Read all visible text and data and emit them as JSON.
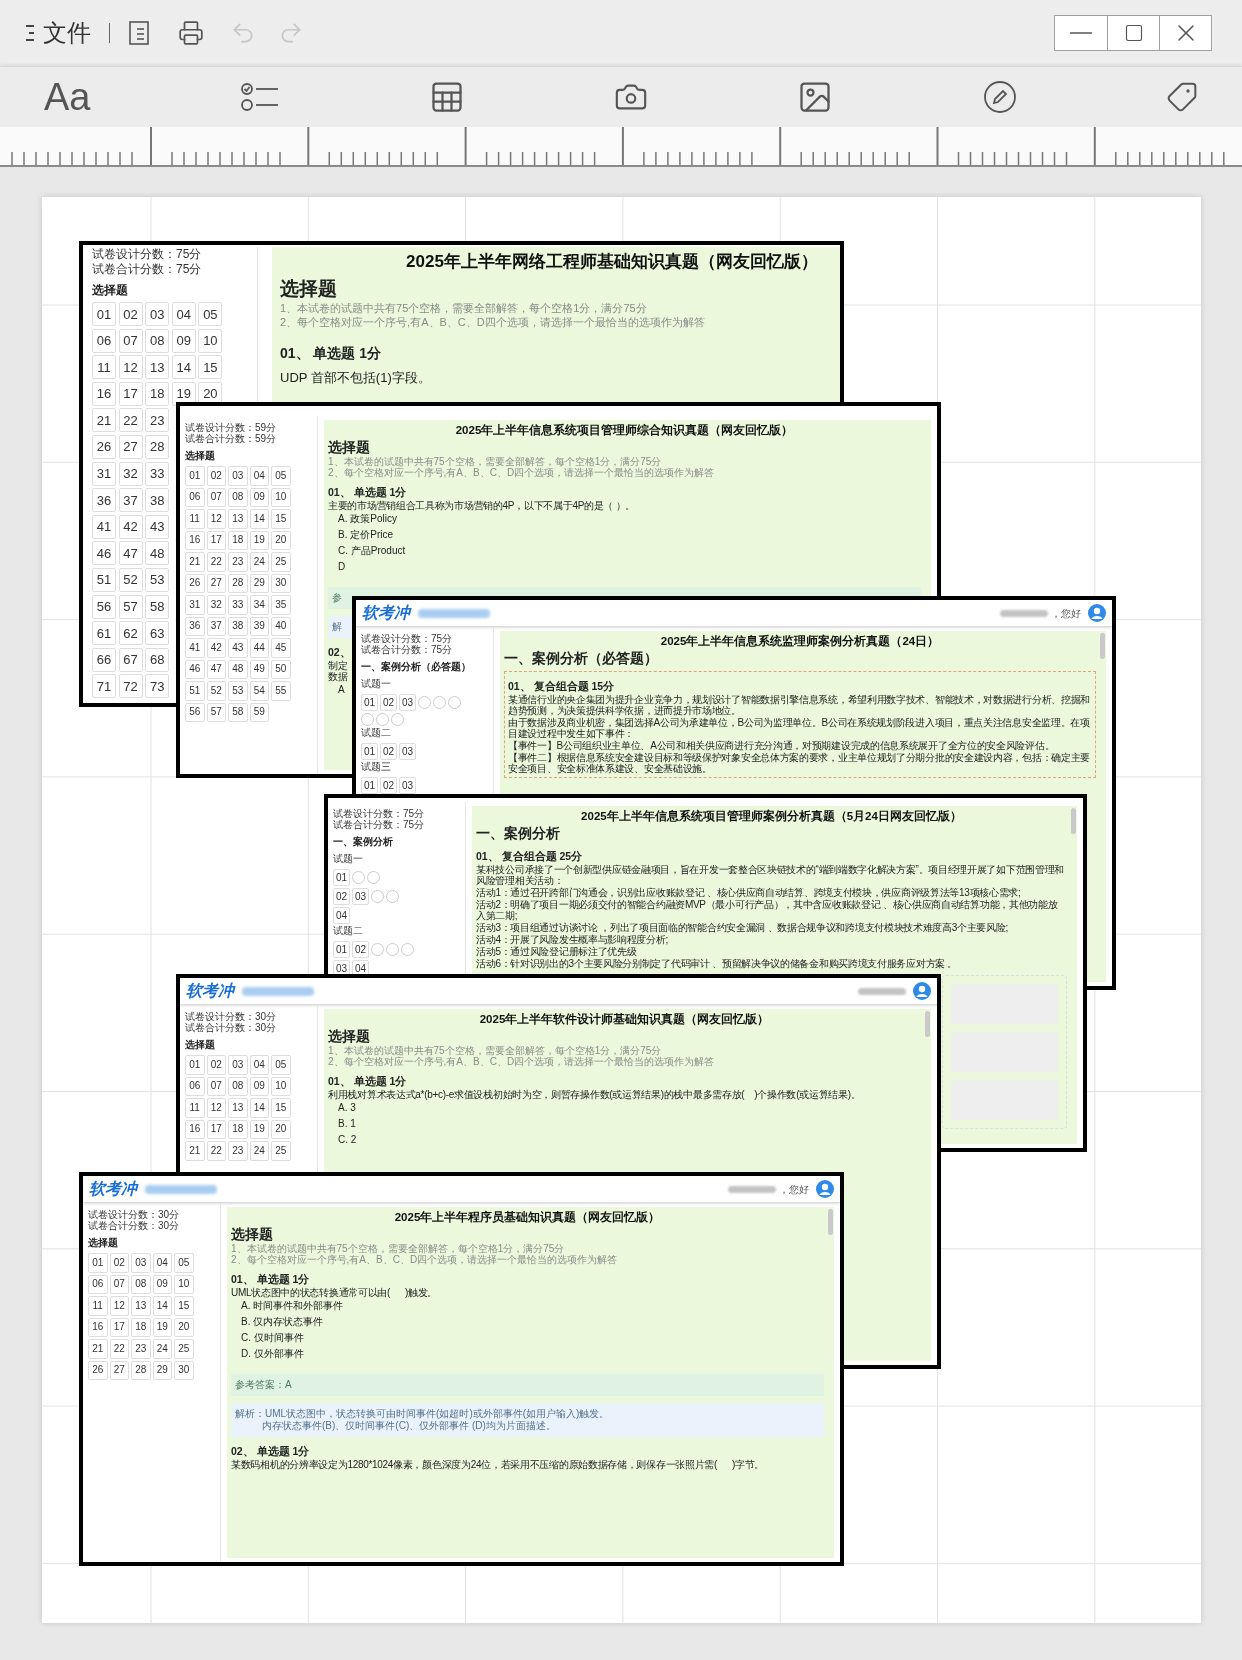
{
  "title_bar": {
    "menu_label": "文件",
    "undo": {
      "disabled": true
    },
    "redo": {
      "disabled": true
    }
  },
  "toolbar": {
    "font_button": "Aa"
  },
  "cards": [
    {
      "sidebar": {
        "scores": [
          "试卷设计分数：75分",
          "试卷合计分数：75分"
        ],
        "section": "选择题",
        "groups": [
          {
            "rows": [
              [
                "01",
                "02",
                "03",
                "04",
                "05"
              ],
              [
                "06",
                "07",
                "08",
                "09",
                "10"
              ],
              [
                "11",
                "12",
                "13",
                "14",
                "15"
              ],
              [
                "16",
                "17",
                "18",
                "19",
                "20"
              ],
              [
                "21",
                "22",
                "23"
              ],
              [
                "26",
                "27",
                "28"
              ],
              [
                "31",
                "32",
                "33"
              ],
              [
                "36",
                "37",
                "38"
              ],
              [
                "41",
                "42",
                "43"
              ],
              [
                "46",
                "47",
                "48"
              ],
              [
                "51",
                "52",
                "53"
              ],
              [
                "56",
                "57",
                "58"
              ],
              [
                "61",
                "62",
                "63"
              ],
              [
                "66",
                "67",
                "68"
              ],
              [
                "71",
                "72",
                "73"
              ]
            ]
          }
        ]
      },
      "main": [
        {
          "kind": "title",
          "text": "2025年上半年网络工程师基础知识真题（网友回忆版）"
        },
        {
          "kind": "heading",
          "text": "选择题"
        },
        {
          "kind": "notes",
          "lines": [
            "1、本试卷的试题中共有75个空格，需要全部解答，每个空格1分，满分75分",
            "2、每个空格对应一个序号,有A、B、C、D四个选项，请选择一个最恰当的选项作为解答"
          ]
        },
        {
          "kind": "qhead",
          "text": "01、 单选题 1分"
        },
        {
          "kind": "text",
          "text": "UDP 首部不包括(1)字段。"
        }
      ]
    },
    {
      "sidebar": {
        "scores": [
          "试卷设计分数：59分",
          "试卷合计分数：59分"
        ],
        "section": "选择题",
        "groups": [
          {
            "rows": [
              [
                "01",
                "02",
                "03",
                "04",
                "05"
              ],
              [
                "06",
                "07",
                "08",
                "09",
                "10"
              ],
              [
                "11",
                "12",
                "13",
                "14",
                "15"
              ],
              [
                "16",
                "17",
                "18",
                "19",
                "20"
              ],
              [
                "21",
                "22",
                "23",
                "24",
                "25"
              ],
              [
                "26",
                "27",
                "28",
                "29",
                "30"
              ],
              [
                "31",
                "32",
                "33",
                "34",
                "35"
              ],
              [
                "36",
                "37",
                "38",
                "39",
                "40"
              ],
              [
                "41",
                "42",
                "43",
                "44",
                "45"
              ],
              [
                "46",
                "47",
                "48",
                "49",
                "50"
              ],
              [
                "51",
                "52",
                "53",
                "54",
                "55"
              ],
              [
                "56",
                "57",
                "58",
                "59"
              ]
            ]
          }
        ]
      },
      "main": [
        {
          "kind": "title",
          "text": "2025年上半年信息系统项目管理师综合知识真题（网友回忆版）"
        },
        {
          "kind": "heading",
          "text": "选择题"
        },
        {
          "kind": "notes",
          "lines": [
            "1、本试卷的试题中共有75个空格，需要全部解答，每个空格1分，满分75分",
            "2、每个空格对应一个序号,有A、B、C、D四个选项，请选择一个最恰当的选项作为解答"
          ]
        },
        {
          "kind": "qhead",
          "text": "01、 单选题 1分"
        },
        {
          "kind": "text",
          "text": "主要的市场营销组合工具称为市场营销的4P，以下不属于4P的是（ ）。"
        },
        {
          "kind": "option",
          "text": "A. 政策Policy"
        },
        {
          "kind": "option",
          "text": "B. 定价Price"
        },
        {
          "kind": "option",
          "text": "C. 产品Product"
        },
        {
          "kind": "option",
          "text": "D"
        },
        {
          "kind": "answer",
          "text": "参"
        },
        {
          "kind": "analysis",
          "lines": [
            "解"
          ]
        },
        {
          "kind": "qhead",
          "text": "02、"
        },
        {
          "kind": "text",
          "lines": [
            "制定",
            "数据"
          ]
        },
        {
          "kind": "option",
          "text": "A"
        }
      ]
    },
    {
      "header": {
        "logo": "软考冲",
        "greeting": "，您好"
      },
      "sidebar": {
        "scores": [
          "试卷设计分数：75分",
          "试卷合计分数：75分"
        ],
        "section": "一、案例分析（必答题）",
        "groups": [
          {
            "label": "试题一",
            "rows": [
              [
                {
                  "kind": "number",
                  "label": "01"
                },
                {
                  "kind": "number",
                  "label": "02"
                },
                {
                  "kind": "number",
                  "label": "03"
                },
                {
                  "kind": "empty"
                },
                {
                  "kind": "empty"
                },
                {
                  "kind": "empty"
                }
              ],
              [
                {
                  "kind": "empty"
                },
                {
                  "kind": "empty"
                },
                {
                  "kind": "empty"
                }
              ]
            ]
          },
          {
            "label": "试题二",
            "rows": [
              [
                {
                  "kind": "number",
                  "label": "01"
                },
                {
                  "kind": "number",
                  "label": "02"
                },
                {
                  "kind": "number",
                  "label": "03"
                }
              ]
            ]
          },
          {
            "label": "试题三",
            "rows": [
              [
                {
                  "kind": "number",
                  "label": "01"
                },
                {
                  "kind": "number",
                  "label": "02"
                },
                {
                  "kind": "number",
                  "label": "03"
                }
              ]
            ]
          }
        ]
      },
      "main": [
        {
          "kind": "title",
          "text": "2025年上半年信息系统监理师案例分析真题（24日）"
        },
        {
          "kind": "heading",
          "text": "一、案例分析（必答题）"
        },
        {
          "kind": "case_box",
          "children": [
            {
              "kind": "qhead",
              "text": "01、 复合组合题 15分"
            },
            {
              "kind": "text",
              "text": "某通信行业的央企集团为提升企业竞争力，规划设计了智能数据引擎信息系统，希望利用数字技术、智能技术，对数据进行分析、挖掘和趋势预测，为决策提供科学依据，进而提升市场地位。"
            },
            {
              "kind": "text",
              "text": "由于数据涉及商业机密，集团选择A公司为承建单位，B公司为监理单位。B公司在系统规划阶段进入项目，重点关注信息安全监理。在项目建设过程中发生如下事件："
            },
            {
              "kind": "text",
              "text": "【事件一】B公司组织业主单位、A公司和相关供应商进行充分沟通，对预期建设完成的信息系统展开了全方位的安全风险评估。"
            },
            {
              "kind": "text",
              "text": "【事件二】根据信息系统安全建设目标和等级保护对象安全总体方案的要求，业主单位规划了分期分批的安全建设内容，包括：确定主要安全项目、安全标准体系建设、安全基础设施。"
            }
          ]
        }
      ]
    },
    {
      "sidebar": {
        "scores": [
          "试卷设计分数：75分",
          "试卷合计分数：75分"
        ],
        "section": "一、案例分析",
        "groups": [
          {
            "label": "试题一",
            "rows": [
              [
                {
                  "kind": "number",
                  "label": "01"
                },
                {
                  "kind": "empty"
                },
                {
                  "kind": "empty"
                }
              ],
              [
                {
                  "kind": "number",
                  "label": "02"
                },
                {
                  "kind": "number",
                  "label": "03"
                },
                {
                  "kind": "empty"
                },
                {
                  "kind": "empty"
                }
              ],
              [
                {
                  "kind": "number",
                  "label": "04"
                }
              ]
            ]
          },
          {
            "label": "试题二",
            "rows": [
              [
                {
                  "kind": "number",
                  "label": "01"
                },
                {
                  "kind": "number",
                  "label": "02"
                },
                {
                  "kind": "empty"
                },
                {
                  "kind": "empty"
                },
                {
                  "kind": "empty"
                }
              ],
              [
                {
                  "kind": "number",
                  "label": "03"
                },
                {
                  "kind": "number",
                  "label": "04"
                }
              ]
            ]
          }
        ]
      },
      "main": [
        {
          "kind": "title",
          "text": "2025年上半年信息系统项目管理师案例分析真题（5月24日网友回忆版）"
        },
        {
          "kind": "heading",
          "text": "一、案例分析"
        },
        {
          "kind": "qhead",
          "text": "01、 复合组合题 25分"
        },
        {
          "kind": "text",
          "text": "某科技公司承接了一个创新型供应链金融项目，旨在开发一套整合区块链技术的“端到端数字化解决方案”。项目经理开展了如下范围管理和风险管理相关活动："
        },
        {
          "kind": "text",
          "text": "活动1：通过召开跨部门沟通会，识别出应收账款登记 、核心供应商自动结算、跨境支付模块，供应商评级算法等13项核心需求;"
        },
        {
          "kind": "text",
          "text": "活动2：明确了项目一期必须交付的智能合约融资MVP（最小可行产品），其中含应收账款登记 、核心供应商自动结算功能，其他功能放入第二期;"
        },
        {
          "kind": "text",
          "text": "活动3：项目组通过访谈讨论 ，列出了项目面临的智能合约安全漏洞 、数据合规争议和跨境支付模块技术难度高3个主要风险;"
        },
        {
          "kind": "text",
          "text": "活动4：开展了风险发生概率与影响程度分析;"
        },
        {
          "kind": "text",
          "text": "活动5：通过风险登记册标注了优先级"
        },
        {
          "kind": "text",
          "text": "活动6：针对识别出的3个主要风险分别制定了代码审计 、预留解决争议的储备金和购买跨境支付服务应对方案 。"
        },
        {
          "kind": "fields"
        }
      ]
    },
    {
      "header": {
        "logo": "软考冲"
      },
      "sidebar": {
        "scores": [
          "试卷设计分数：30分",
          "试卷合计分数：30分"
        ],
        "section": "选择题",
        "groups": [
          {
            "rows": [
              [
                "01",
                "02",
                "03",
                "04",
                "05"
              ],
              [
                "06",
                "07",
                "08",
                "09",
                "10"
              ],
              [
                "11",
                "12",
                "13",
                "14",
                "15"
              ],
              [
                "16",
                "17",
                "18",
                "19",
                "20"
              ],
              [
                "21",
                "22",
                "23",
                "24",
                "25"
              ]
            ]
          }
        ]
      },
      "main": [
        {
          "kind": "title",
          "text": "2025年上半年软件设计师基础知识真题（网友回忆版）"
        },
        {
          "kind": "heading",
          "text": "选择题"
        },
        {
          "kind": "notes",
          "lines": [
            "1、本试卷的试题中共有75个空格，需要全部解答，每个空格1分，满分75分",
            "2、每个空格对应一个序号,有A、B、C、D四个选项，请选择一个最恰当的选项作为解答"
          ]
        },
        {
          "kind": "qhead",
          "text": "01、 单选题 1分"
        },
        {
          "kind": "text",
          "text": "利用栈对算术表达式a*(b+c)-e求值设栈初始时为空，则暂存操作数(或运算结果)的栈中最多需存放(    )个操作数(或运算结果)。"
        },
        {
          "kind": "option",
          "text": "A. 3"
        },
        {
          "kind": "option",
          "text": "B. 1"
        },
        {
          "kind": "option",
          "text": "C. 2"
        }
      ]
    },
    {
      "header": {
        "logo": "软考冲",
        "greeting": "，您好"
      },
      "sidebar": {
        "scores": [
          "试卷设计分数：30分",
          "试卷合计分数：30分"
        ],
        "section": "选择题",
        "groups": [
          {
            "rows": [
              [
                "01",
                "02",
                "03",
                "04",
                "05"
              ],
              [
                "06",
                "07",
                "08",
                "09",
                "10"
              ],
              [
                "11",
                "12",
                "13",
                "14",
                "15"
              ],
              [
                "16",
                "17",
                "18",
                "19",
                "20"
              ],
              [
                "21",
                "22",
                "23",
                "24",
                "25"
              ],
              [
                "26",
                "27",
                "28",
                "29",
                "30"
              ]
            ]
          }
        ]
      },
      "main": [
        {
          "kind": "title",
          "text": "2025年上半年程序员基础知识真题（网友回忆版）"
        },
        {
          "kind": "heading",
          "text": "选择题"
        },
        {
          "kind": "notes",
          "lines": [
            "1、本试卷的试题中共有75个空格，需要全部解答，每个空格1分，满分75分",
            "2、每个空格对应一个序号,有A、B、C、D四个选项，请选择一个最恰当的选项作为解答"
          ]
        },
        {
          "kind": "qhead",
          "text": "01、 单选题 1分"
        },
        {
          "kind": "text",
          "text": "UML状态图中的状态转换通常可以由(      )触发。"
        },
        {
          "kind": "option",
          "text": "A. 时间事件和外部事件"
        },
        {
          "kind": "option",
          "text": "B. 仅内存状态事件"
        },
        {
          "kind": "option",
          "text": "C. 仅时间事件"
        },
        {
          "kind": "option",
          "text": "D. 仅外部事件"
        },
        {
          "kind": "answer",
          "text": "参考答案：A"
        },
        {
          "kind": "analysis",
          "lines": [
            "解析：UML状态图中，状态转换可由时间事件(如超时)或外部事件(如用户输入)触发。",
            "内存状态事件(B)、仅时间事件(C)、仅外部事件 (D)均为片面描述。"
          ]
        },
        {
          "kind": "qhead",
          "text": "02、 单选题 1分"
        },
        {
          "kind": "text",
          "text": "某数码相机的分辨率设定为1280*1024像素，颜色深度为24位，若采用不压缩的原始数据存储，则保存一张照片需(      )字节。"
        }
      ]
    }
  ]
}
